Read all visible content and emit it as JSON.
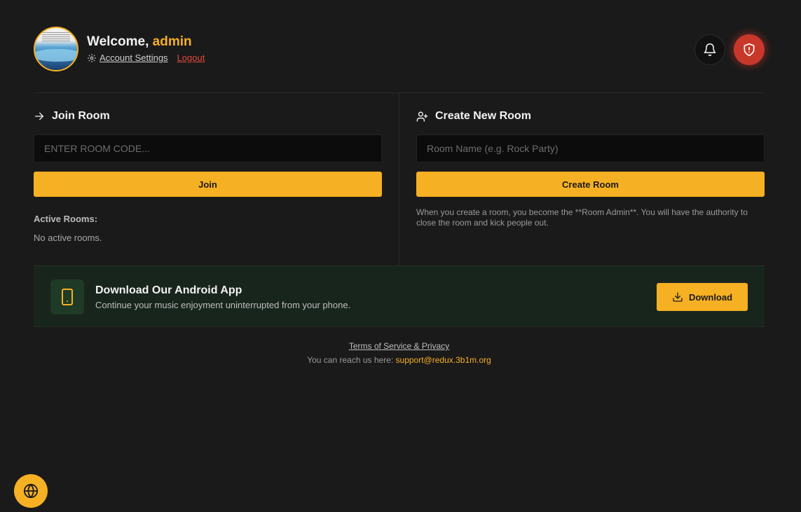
{
  "header": {
    "welcome_prefix": "Welcome,",
    "username": "admin",
    "account_settings": "Account Settings",
    "logout": "Logout"
  },
  "join": {
    "title": "Join Room",
    "placeholder": "ENTER ROOM CODE...",
    "button": "Join",
    "active_label": "Active Rooms:",
    "active_empty": "No active rooms."
  },
  "create": {
    "title": "Create New Room",
    "placeholder": "Room Name (e.g. Rock Party)",
    "button": "Create Room",
    "note": "When you create a room, you become the **Room Admin**. You will have the authority to close the room and kick people out."
  },
  "banner": {
    "title": "Download Our Android App",
    "subtitle": "Continue your music enjoyment uninterrupted from your phone.",
    "button": "Download"
  },
  "footer": {
    "terms": "Terms of Service & Privacy",
    "reach": "You can reach us here:",
    "email": "support@redux.3b1m.org"
  },
  "colors": {
    "accent": "#f6b023",
    "danger": "#c8382a",
    "background": "#1a1a1a"
  }
}
